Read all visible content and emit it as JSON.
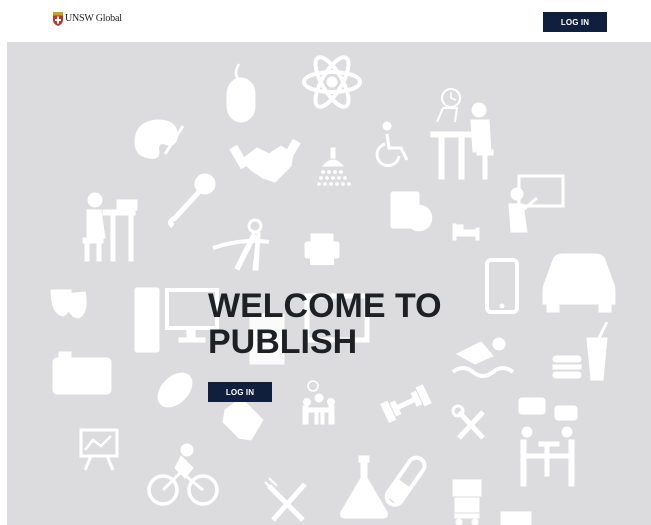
{
  "header": {
    "brand": "UNSW Global",
    "login_label": "LOG IN"
  },
  "hero": {
    "title": "WELCOME TO\nPUBLISH",
    "login_label": "LOG IN",
    "background_color": "#dcdcde"
  },
  "colors": {
    "button": "#0f1f3d",
    "button_text": "#ffffff",
    "title_text": "#1e2023",
    "icon": "#ffffff"
  },
  "icons": [
    "mouse-icon",
    "atom-icon",
    "palette-icon",
    "handshake-icon",
    "shower-icon",
    "wheelchair-icon",
    "student-desk-icon",
    "microphone-icon",
    "teacher-board-icon",
    "studying-person-icon",
    "compass-icon",
    "dvd-case-icon",
    "printer-icon",
    "bed-icon",
    "smartphone-icon",
    "car-icon",
    "theatre-masks-icon",
    "desktop-computer-icon",
    "camera-icon",
    "swimming-icon",
    "fast-food-icon",
    "football-icon",
    "tag-icon",
    "meeting-icon",
    "dumbbell-icon",
    "tools-icon",
    "discussion-icon",
    "presentation-chart-icon",
    "cycling-icon",
    "cutlery-icon",
    "laboratory-flask-icon",
    "luggage-trolley-icon"
  ]
}
